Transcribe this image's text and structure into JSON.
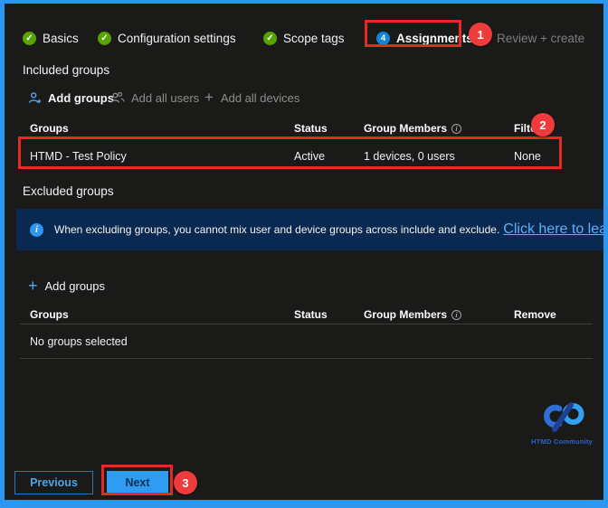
{
  "steps": {
    "completed": [
      {
        "label": "Basics"
      },
      {
        "label": "Configuration settings"
      },
      {
        "label": "Scope tags"
      }
    ],
    "current": {
      "number": "4",
      "label": "Assignments"
    },
    "upcoming": {
      "label": "Review + create"
    }
  },
  "annotations": {
    "one": "1",
    "two": "2",
    "three": "3"
  },
  "icons": {
    "check": "✓",
    "plus": "+",
    "info": "i"
  },
  "included": {
    "heading": "Included groups",
    "actions": [
      {
        "label": "Add groups"
      },
      {
        "label": "Add all users"
      },
      {
        "label": "Add all devices"
      }
    ],
    "table": {
      "headers": [
        "Groups",
        "Status",
        "Group Members",
        "Filter"
      ],
      "rows": [
        [
          "HTMD - Test Policy",
          "Active",
          "1 devices, 0 users",
          "None"
        ]
      ]
    }
  },
  "excluded": {
    "heading": "Excluded groups",
    "banner": {
      "text": "When excluding groups, you cannot mix user and device groups across include and exclude.",
      "link": "Click here to learn more about"
    },
    "add_label": "Add groups",
    "table": {
      "headers": [
        "Groups",
        "Status",
        "Group Members",
        "Remove"
      ],
      "empty": "No groups selected"
    }
  },
  "footer": {
    "previous": "Previous",
    "next": "Next"
  },
  "logo": {
    "text": "HTMD Community"
  },
  "colors": {
    "frame_blue": "#2b97f0",
    "panel_bg": "#1a1a19",
    "annotation_red": "#e32a24",
    "step_done_green": "#57a300",
    "step_current_blue": "#1583d7",
    "banner_bg": "#0a2950",
    "primary_button_blue": "#2f9cf4",
    "link_blue": "#5ab2f8"
  }
}
